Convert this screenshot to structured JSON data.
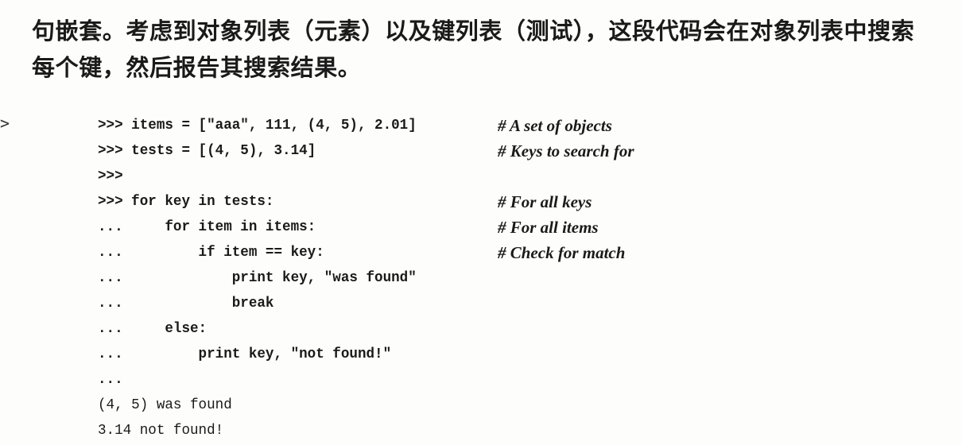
{
  "paragraph": {
    "line1": "句嵌套。考虑到对象列表（元素）以及键列表（测试），这段代码会在对象列表中搜索",
    "line2": "每个键，然后报告其搜索结果。"
  },
  "margin_marker": ">",
  "code": [
    {
      "text": ">>> items = [\"aaa\", 111, (4, 5), 2.01]",
      "comment": "# A set of objects"
    },
    {
      "text": ">>> tests = [(4, 5), 3.14]",
      "comment": "# Keys to search for"
    },
    {
      "text": ">>>",
      "comment": ""
    },
    {
      "text": ">>> for key in tests:",
      "comment": "# For all keys"
    },
    {
      "text": "...     for item in items:",
      "comment": "# For all items"
    },
    {
      "text": "...         if item == key:",
      "comment": "# Check for match"
    },
    {
      "text": "...             print key, \"was found\"",
      "comment": ""
    },
    {
      "text": "...             break",
      "comment": ""
    },
    {
      "text": "...     else:",
      "comment": ""
    },
    {
      "text": "...         print key, \"not found!\"",
      "comment": ""
    },
    {
      "text": "...",
      "comment": ""
    }
  ],
  "output": [
    "(4, 5) was found",
    "3.14 not found!"
  ]
}
